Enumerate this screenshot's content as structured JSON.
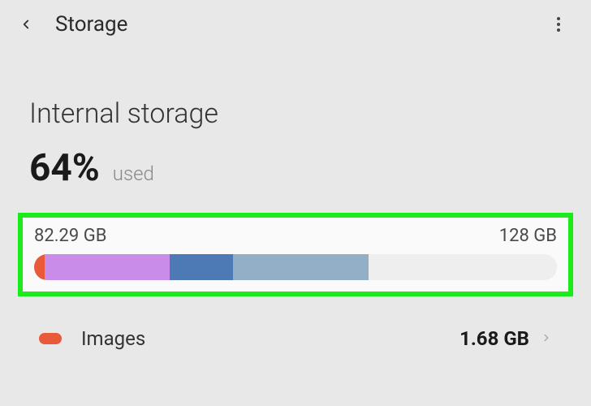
{
  "header": {
    "title": "Storage"
  },
  "section": {
    "title": "Internal storage",
    "usage_percent": "64%",
    "usage_label": "used"
  },
  "bar": {
    "used_label": "82.29 GB",
    "total_label": "128 GB",
    "segments": [
      {
        "class": "seg-red"
      },
      {
        "class": "seg-purple"
      },
      {
        "class": "seg-blue"
      },
      {
        "class": "seg-lightblue"
      },
      {
        "class": "seg-empty"
      }
    ]
  },
  "categories": [
    {
      "swatch": "swatch-red",
      "label": "Images",
      "size": "1.68 GB"
    }
  ]
}
